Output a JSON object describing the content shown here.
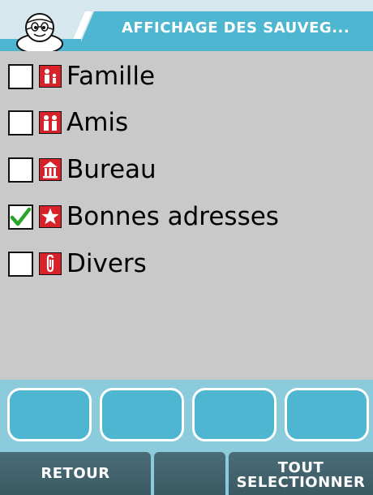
{
  "header": {
    "title": "AFFICHAGE DES SAUVEG..."
  },
  "items": [
    {
      "label": "Famille",
      "checked": false,
      "icon": "family-icon"
    },
    {
      "label": "Amis",
      "checked": false,
      "icon": "friends-icon"
    },
    {
      "label": "Bureau",
      "checked": false,
      "icon": "office-icon"
    },
    {
      "label": "Bonnes adresses",
      "checked": true,
      "icon": "star-icon"
    },
    {
      "label": "Divers",
      "checked": false,
      "icon": "paperclip-icon"
    }
  ],
  "softkeys": {
    "left_label": "RETOUR",
    "right_label_line1": "TOUT",
    "right_label_line2": "SELECTIONNER"
  },
  "colors": {
    "background": "#c9c9c9",
    "header_accent": "#4fb6d2",
    "icon_red": "#d8222a",
    "check_green": "#2aa52a",
    "softkey": "#3f5f69"
  }
}
